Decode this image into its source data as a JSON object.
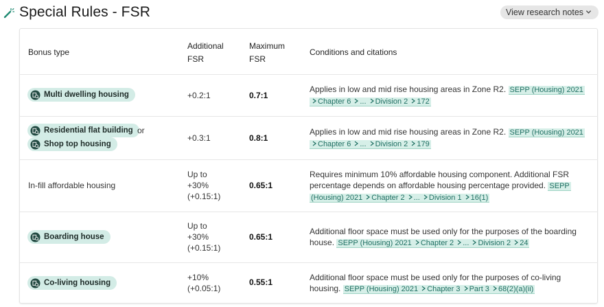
{
  "header": {
    "title": "Special Rules - FSR",
    "notes_button": "View research notes"
  },
  "table": {
    "headers": {
      "bonus_type": "Bonus type",
      "additional_fsr_1": "Additional",
      "additional_fsr_2": "FSR",
      "maximum_fsr_1": "Maximum",
      "maximum_fsr_2": "FSR",
      "conditions": "Conditions and citations"
    },
    "rows": [
      {
        "bonus": "Multi dwelling housing",
        "additional": "+0.2:1",
        "maximum": "0.7:1",
        "condition": "Applies in low and mid rise housing areas in Zone R2.",
        "citation": [
          "SEPP (Housing) 2021",
          "Chapter 6",
          "...",
          "Division 2",
          "172"
        ]
      },
      {
        "bonus": "Residential flat building",
        "or": "or",
        "bonus2": "Shop top housing",
        "additional": "+0.3:1",
        "maximum": "0.8:1",
        "condition": "Applies in low and mid rise housing areas in Zone R2.",
        "citation": [
          "SEPP (Housing) 2021",
          "Chapter 6",
          "...",
          "Division 2",
          "179"
        ]
      },
      {
        "bonus": "In-fill affordable housing",
        "additional_1": "Up to",
        "additional_2": "+30%",
        "additional_3": "(+0.15:1)",
        "maximum": "0.65:1",
        "condition_1": "Requires minimum 10% affordable housing component. Additional FSR",
        "condition_2": "percentage depends on affordable housing percentage provided.",
        "citation": [
          "SEPP",
          "(Housing) 2021",
          "Chapter 2",
          "...",
          "Division 1",
          "16(1)"
        ]
      },
      {
        "bonus": "Boarding house",
        "additional_1": "Up to",
        "additional_2": "+30%",
        "additional_3": "(+0.15:1)",
        "maximum": "0.65:1",
        "condition_1": "Additional floor space must be used only for the purposes of the boarding",
        "condition_2": "house.",
        "citation": [
          "SEPP (Housing) 2021",
          "Chapter 2",
          "...",
          "Division 2",
          "24"
        ]
      },
      {
        "bonus": "Co-living housing",
        "additional_1": "+10%",
        "additional_2": "(+0.05:1)",
        "maximum": "0.55:1",
        "condition_1": "Additional floor space must be used only for the purposes of co-living",
        "condition_2": "housing.",
        "citation": [
          "SEPP (Housing) 2021",
          "Chapter 3",
          "Part 3",
          "68(2)(a)(ii)"
        ]
      }
    ]
  },
  "icons": {
    "title_icon": "magic-wand-icon",
    "pill_icon": "building-search-icon",
    "notes_chevron": "chevron-down-icon",
    "citation_separator": "chevron-right-icon"
  },
  "colors": {
    "pill_bg": "#d3ece6",
    "citation_bg": "#d6efe8",
    "citation_text": "#1f6f62",
    "title_icon": "#1f8a72"
  }
}
